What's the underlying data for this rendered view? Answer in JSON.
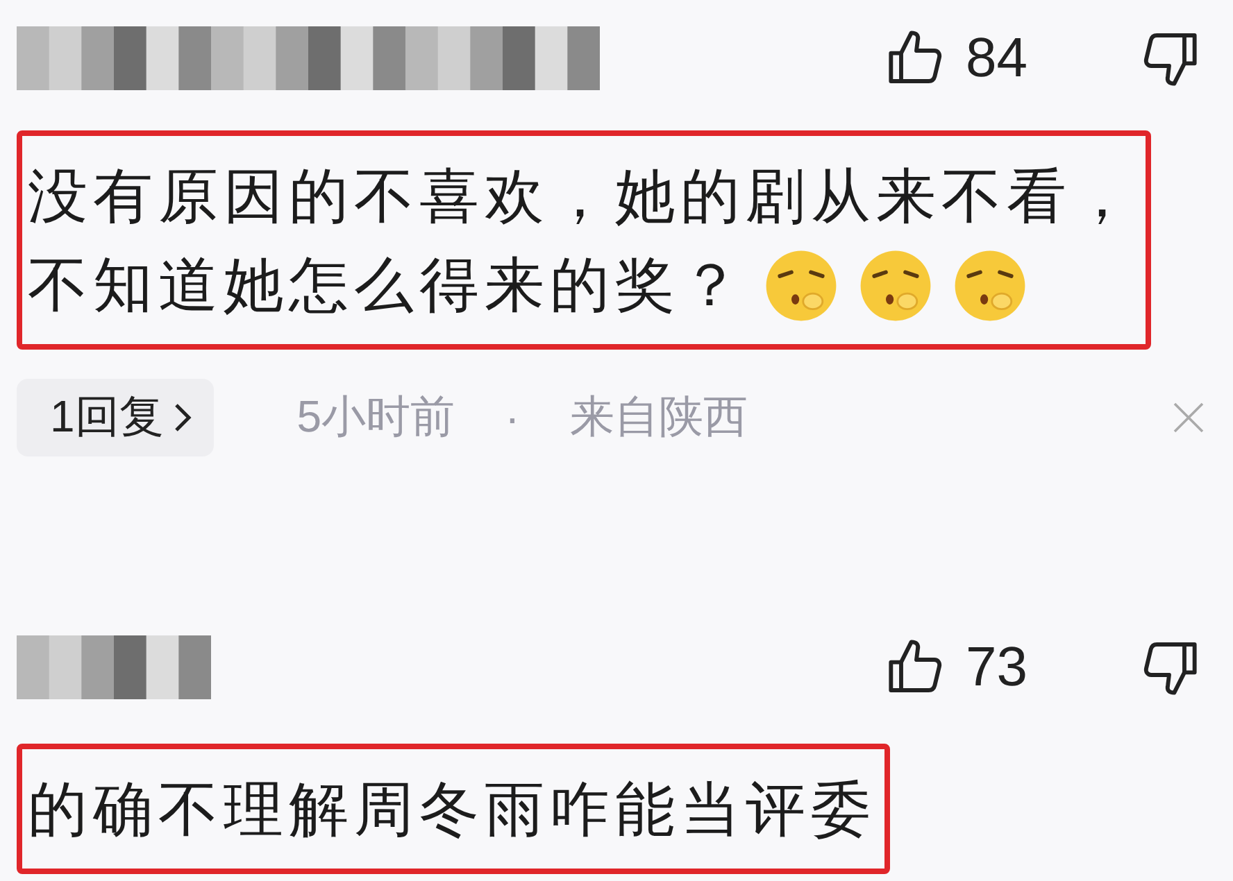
{
  "comments": [
    {
      "likes": "84",
      "highlighted": true,
      "lines": [
        "没有原因的不喜欢，她的剧从来不看，",
        "不知道她怎么得来的奖？"
      ],
      "emojis": [
        {
          "kind": "pensive"
        },
        {
          "kind": "pensive"
        },
        {
          "kind": "pensive"
        }
      ],
      "replies": "1回复",
      "time": "5小时前",
      "separator": "·",
      "location": "来自陕西"
    },
    {
      "likes": "73",
      "highlighted": true,
      "lines": [
        "的确不理解周冬雨咋能当评委"
      ]
    }
  ]
}
